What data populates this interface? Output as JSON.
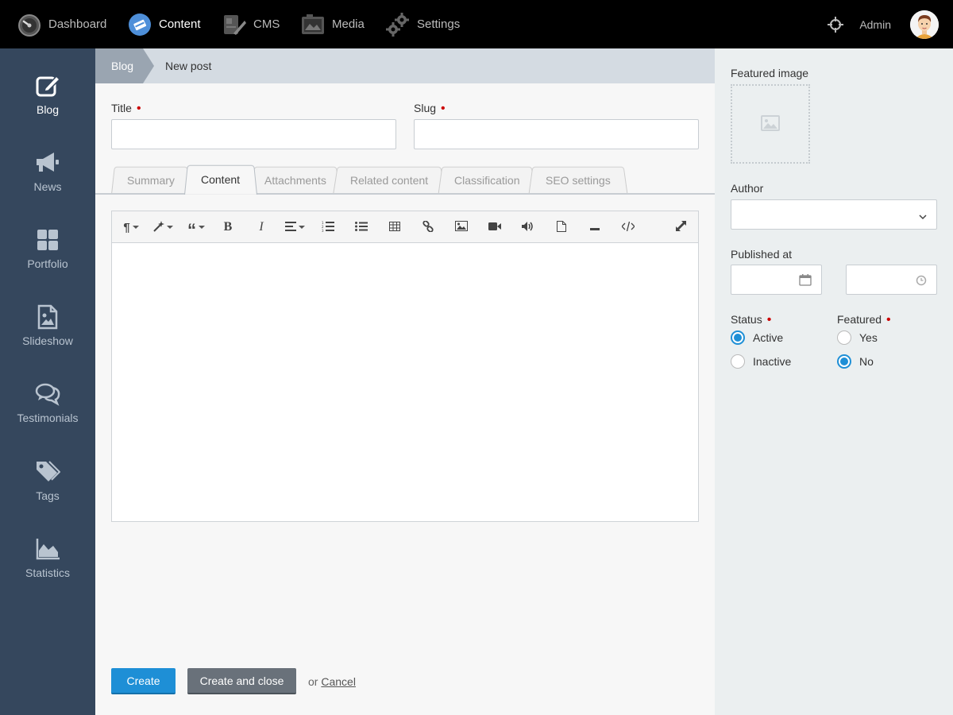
{
  "topnav": {
    "items": [
      {
        "label": "Dashboard",
        "icon": "speedometer-icon"
      },
      {
        "label": "Content",
        "icon": "content-icon",
        "active": true
      },
      {
        "label": "CMS",
        "icon": "cms-icon"
      },
      {
        "label": "Media",
        "icon": "media-icon"
      },
      {
        "label": "Settings",
        "icon": "gears-icon"
      }
    ],
    "user_label": "Admin"
  },
  "sidebar": {
    "items": [
      {
        "label": "Blog",
        "icon": "edit-icon",
        "active": true
      },
      {
        "label": "News",
        "icon": "megaphone-icon"
      },
      {
        "label": "Portfolio",
        "icon": "grid-icon"
      },
      {
        "label": "Slideshow",
        "icon": "image-file-icon"
      },
      {
        "label": "Testimonials",
        "icon": "comments-icon"
      },
      {
        "label": "Tags",
        "icon": "tags-icon"
      },
      {
        "label": "Statistics",
        "icon": "area-chart-icon"
      }
    ]
  },
  "breadcrumb": {
    "parent": "Blog",
    "current": "New post"
  },
  "form": {
    "title_label": "Title",
    "title_value": "",
    "slug_label": "Slug",
    "slug_value": ""
  },
  "tabs": [
    {
      "label": "Summary"
    },
    {
      "label": "Content",
      "active": true
    },
    {
      "label": "Attachments"
    },
    {
      "label": "Related content"
    },
    {
      "label": "Classification"
    },
    {
      "label": "SEO settings"
    }
  ],
  "editor": {
    "toolbar": [
      "paragraph",
      "magic",
      "quote",
      "bold",
      "italic",
      "align",
      "ordered-list",
      "unordered-list",
      "table",
      "link",
      "image",
      "video",
      "audio",
      "file",
      "horizontal-rule",
      "code-view",
      "fullscreen"
    ],
    "content": ""
  },
  "actions": {
    "create_label": "Create",
    "create_close_label": "Create and close",
    "or_label": "or",
    "cancel_label": "Cancel"
  },
  "side_panel": {
    "featured_image_label": "Featured image",
    "author_label": "Author",
    "author_value": "",
    "published_label": "Published at",
    "date_value": "",
    "time_value": "",
    "status_label": "Status",
    "status_options": [
      {
        "label": "Active",
        "checked": true
      },
      {
        "label": "Inactive",
        "checked": false
      }
    ],
    "featured_label": "Featured",
    "featured_options": [
      {
        "label": "Yes",
        "checked": false
      },
      {
        "label": "No",
        "checked": true
      }
    ]
  },
  "colors": {
    "accent": "#1e8fd6",
    "sidebar": "#35475d",
    "topbar": "#000000",
    "required": "#cc0000"
  }
}
